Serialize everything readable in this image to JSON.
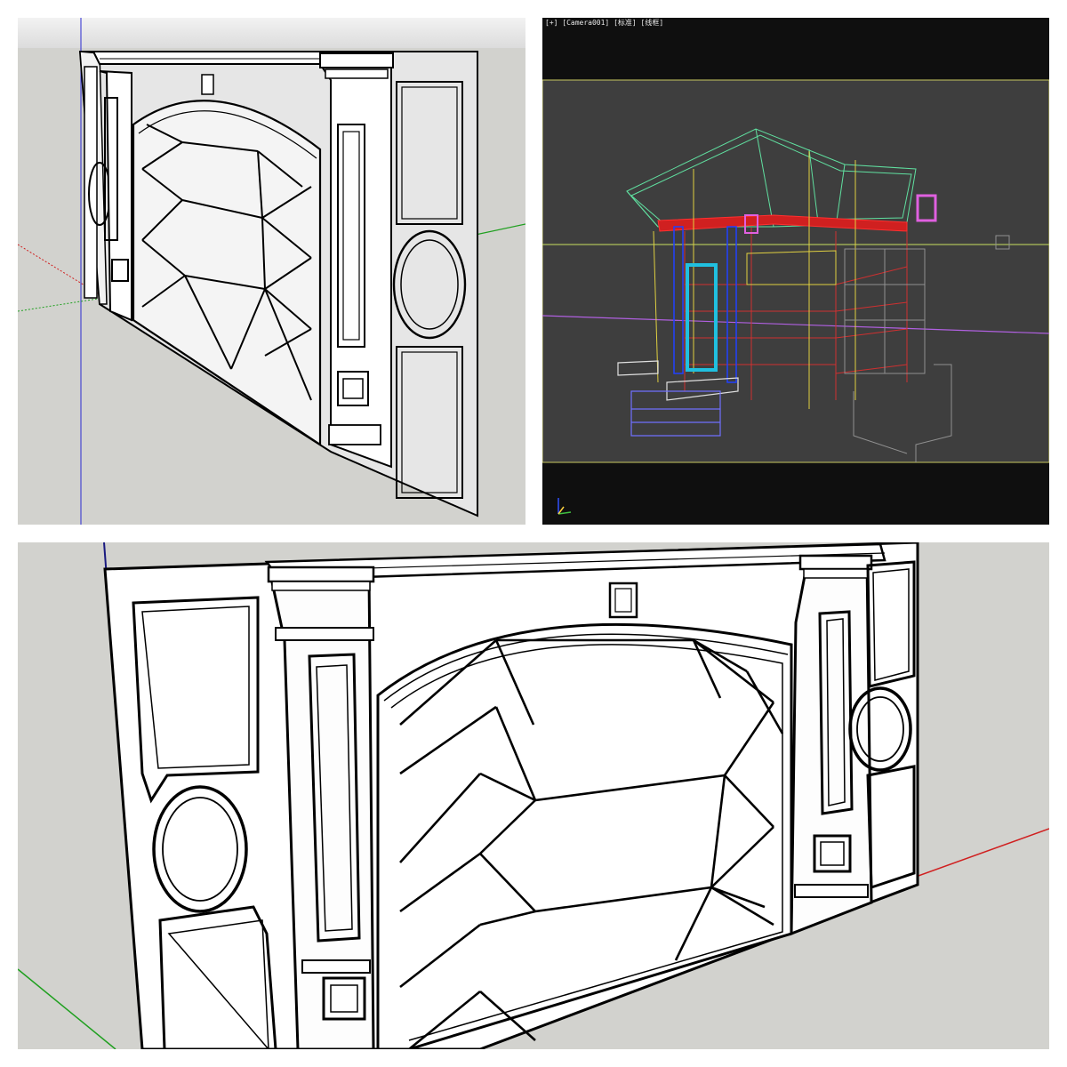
{
  "viewport": {
    "label": "[+] [Camera001] [标准] [线框]"
  },
  "icons": {
    "left_panel": "sketchup-wall-panel-model",
    "right_panel": "3dsmax-wireframe-building",
    "bottom_panel": "sketchup-wall-panel-model-closeup",
    "axis_gizmo": "axis-gizmo-icon"
  },
  "colors": {
    "sketchup_bg": "#d2d2ce",
    "sketchup_sky": "#ececec",
    "max_bg": "#0f0f0f",
    "max_viewport": "#3e3e3e",
    "axis_red": "#d02020",
    "axis_green": "#20a020",
    "axis_blue": "#2020c0"
  }
}
